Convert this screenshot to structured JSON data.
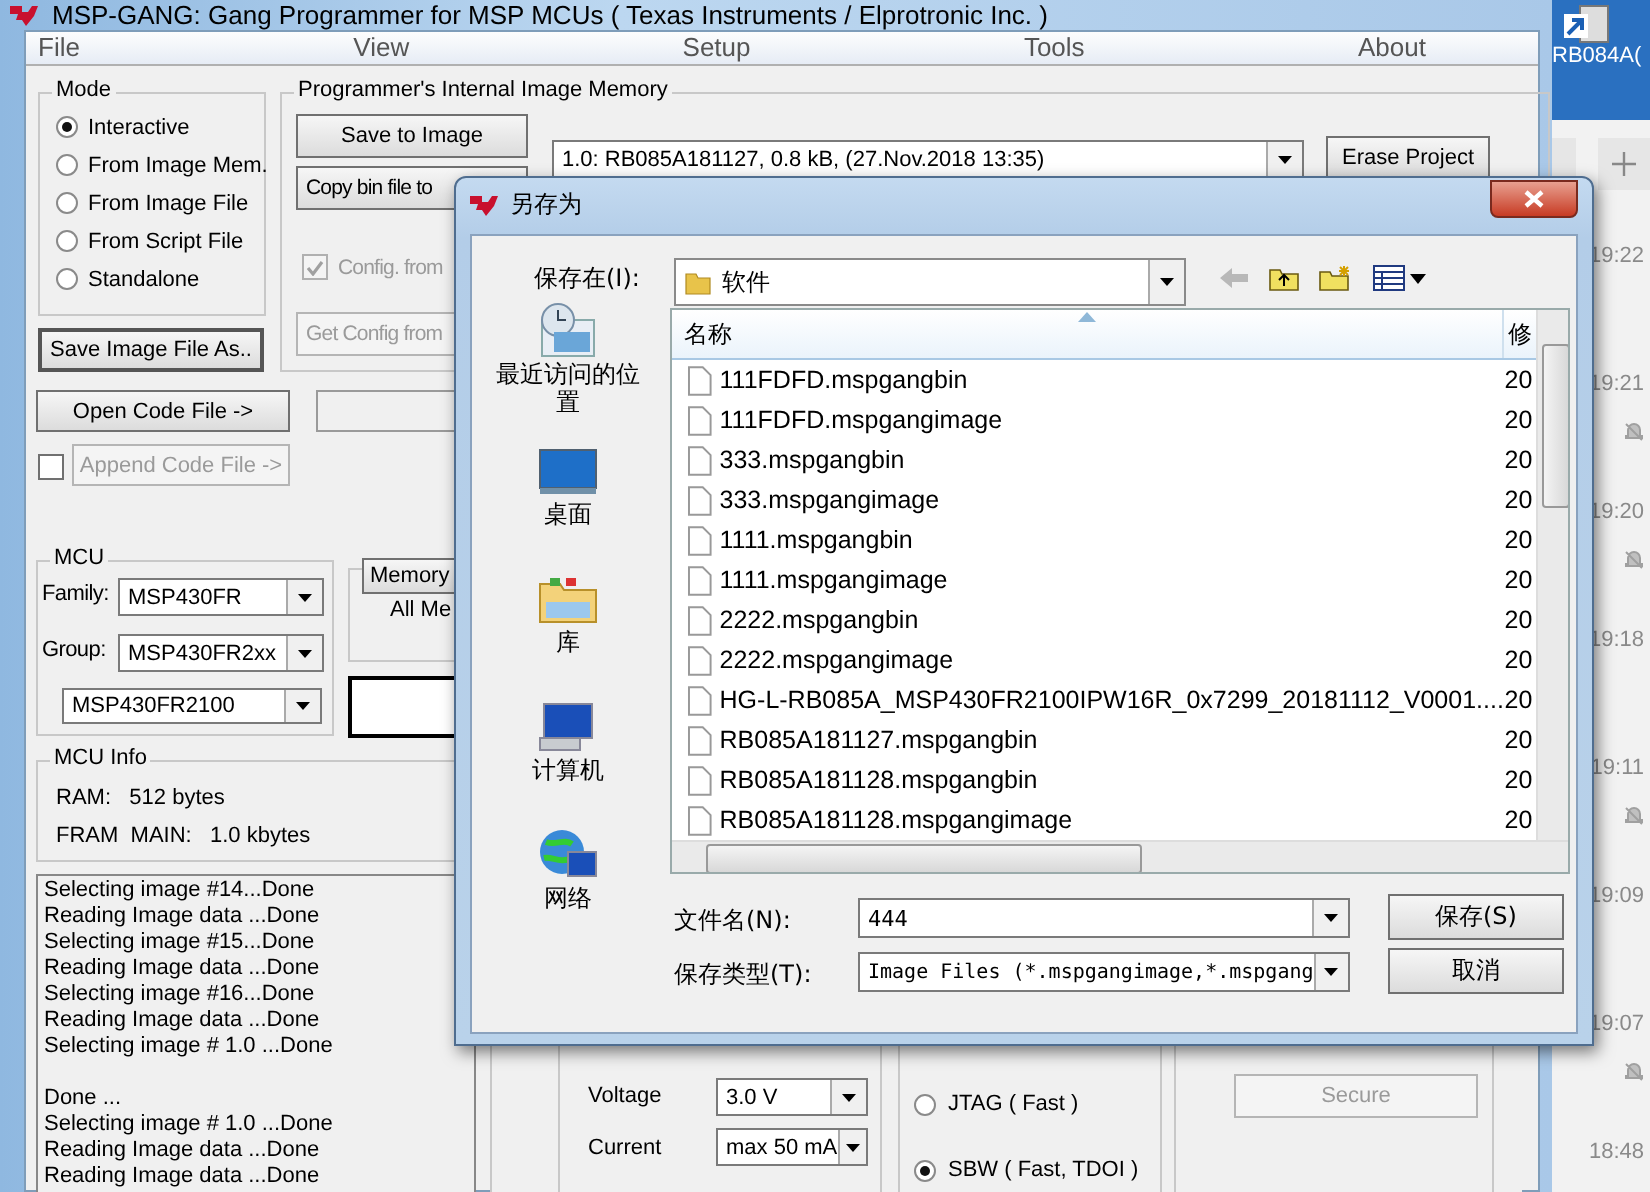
{
  "app": {
    "title": "MSP-GANG: Gang Programmer for MSP MCUs ( Texas Instruments / Elprotronic Inc. )",
    "menu": [
      "File",
      "View",
      "Setup",
      "Tools",
      "About"
    ],
    "mode": {
      "label": "Mode",
      "options": [
        {
          "label": "Interactive",
          "selected": true
        },
        {
          "label": "From Image Mem.",
          "selected": false
        },
        {
          "label": "From Image File",
          "selected": false
        },
        {
          "label": "From Script File",
          "selected": false
        },
        {
          "label": "Standalone",
          "selected": false
        }
      ]
    },
    "save_image_button": "Save Image File As..",
    "image_memory": {
      "label": "Programmer's Internal Image Memory",
      "buttons": [
        {
          "label": "Save to Image",
          "disabled": false
        },
        {
          "label": "Copy bin file to",
          "disabled": false
        }
      ],
      "config_checkbox": {
        "label": "Config. from",
        "checked": true,
        "disabled": true
      },
      "get_config_button": {
        "label": "Get Config from",
        "disabled": true
      },
      "image_select": "1.0: RB085A181127,  0.8 kB,  (27.Nov.2018  13:35)",
      "erase_button": "Erase Project"
    },
    "open_code_button": "Open Code File ->",
    "append": {
      "label": "Append Code File ->",
      "checked": false,
      "disabled": true
    },
    "mcu": {
      "label": "MCU",
      "family_label": "Family:",
      "family": "MSP430FR",
      "group_label": "Group:",
      "group": "MSP430FR2xx",
      "device": "MSP430FR2100"
    },
    "memory_tab": "Memory",
    "memory_text": "All Me",
    "mcu_info": {
      "label": "MCU Info",
      "lines": [
        "RAM:   512 bytes",
        "FRAM  MAIN:   1.0 kbytes"
      ]
    },
    "log": [
      [
        "Selecting image #14...Done",
        "Reading Image data ...Done",
        "Selecting image #15...Done",
        "Reading Image data ...Done",
        "Selecting image #16...Done",
        "Reading Image data ...Done",
        "Selecting image # 1.0 ...Done"
      ],
      [
        "Done ...",
        "Selecting image # 1.0 ...Done",
        "Reading Image data ...Done",
        "Reading Image data ...Done"
      ]
    ],
    "supply": [
      {
        "label": "Voltage",
        "value": "3.0 V"
      },
      {
        "label": "Current",
        "value": "max 50 mA"
      }
    ],
    "interface": [
      {
        "label": "JTAG ( Fast )",
        "selected": false
      },
      {
        "label": "SBW ( Fast, TDOI )",
        "selected": true
      }
    ],
    "secure_button": {
      "label": "Secure",
      "disabled": true
    }
  },
  "dialog": {
    "title": "另存为",
    "save_in_label": "保存在(I):",
    "save_in": "软件",
    "places": [
      {
        "kind": "recent",
        "label": "最近访问的位置"
      },
      {
        "kind": "desktop",
        "label": "桌面"
      },
      {
        "kind": "library",
        "label": "库"
      },
      {
        "kind": "computer",
        "label": "计算机"
      },
      {
        "kind": "network",
        "label": "网络"
      }
    ],
    "columns": [
      "名称",
      "修"
    ],
    "files": [
      {
        "name": "111FDFD.mspgangbin",
        "column_2": "20"
      },
      {
        "name": "111FDFD.mspgangimage",
        "column_2": "20"
      },
      {
        "name": "333.mspgangbin",
        "column_2": "20"
      },
      {
        "name": "333.mspgangimage",
        "column_2": "20"
      },
      {
        "name": "1111.mspgangbin",
        "column_2": "20"
      },
      {
        "name": "1111.mspgangimage",
        "column_2": "20"
      },
      {
        "name": "2222.mspgangbin",
        "column_2": "20"
      },
      {
        "name": "2222.mspgangimage",
        "column_2": "20"
      },
      {
        "name": "HG-L-RB085A_MSP430FR2100IPW16R_0x7299_20181112_V0001....",
        "column_2": "20"
      },
      {
        "name": "RB085A181127.mspgangbin",
        "column_2": "20"
      },
      {
        "name": "RB085A181128.mspgangbin",
        "column_2": "20"
      },
      {
        "name": "RB085A181128.mspgangimage",
        "column_2": "20"
      }
    ],
    "file_name_label": "文件名(N):",
    "file_name": "444",
    "file_type_label": "保存类型(T):",
    "file_type": "Image Files (*.mspgangimage,*.mspgang",
    "buttons": [
      "保存(S)",
      "取消"
    ]
  },
  "desktop": {
    "icon_label": "RB084A(",
    "times": [
      {
        "time": "19:22",
        "muted": false
      },
      {
        "time": "19:21",
        "muted": true
      },
      {
        "time": "19:20",
        "muted": true
      },
      {
        "time": "19:18",
        "muted": false
      },
      {
        "time": "19:11",
        "muted": true
      },
      {
        "time": "19:09",
        "muted": false
      },
      {
        "time": "19:07",
        "muted": true
      },
      {
        "time": "18:48",
        "muted": false
      }
    ]
  }
}
